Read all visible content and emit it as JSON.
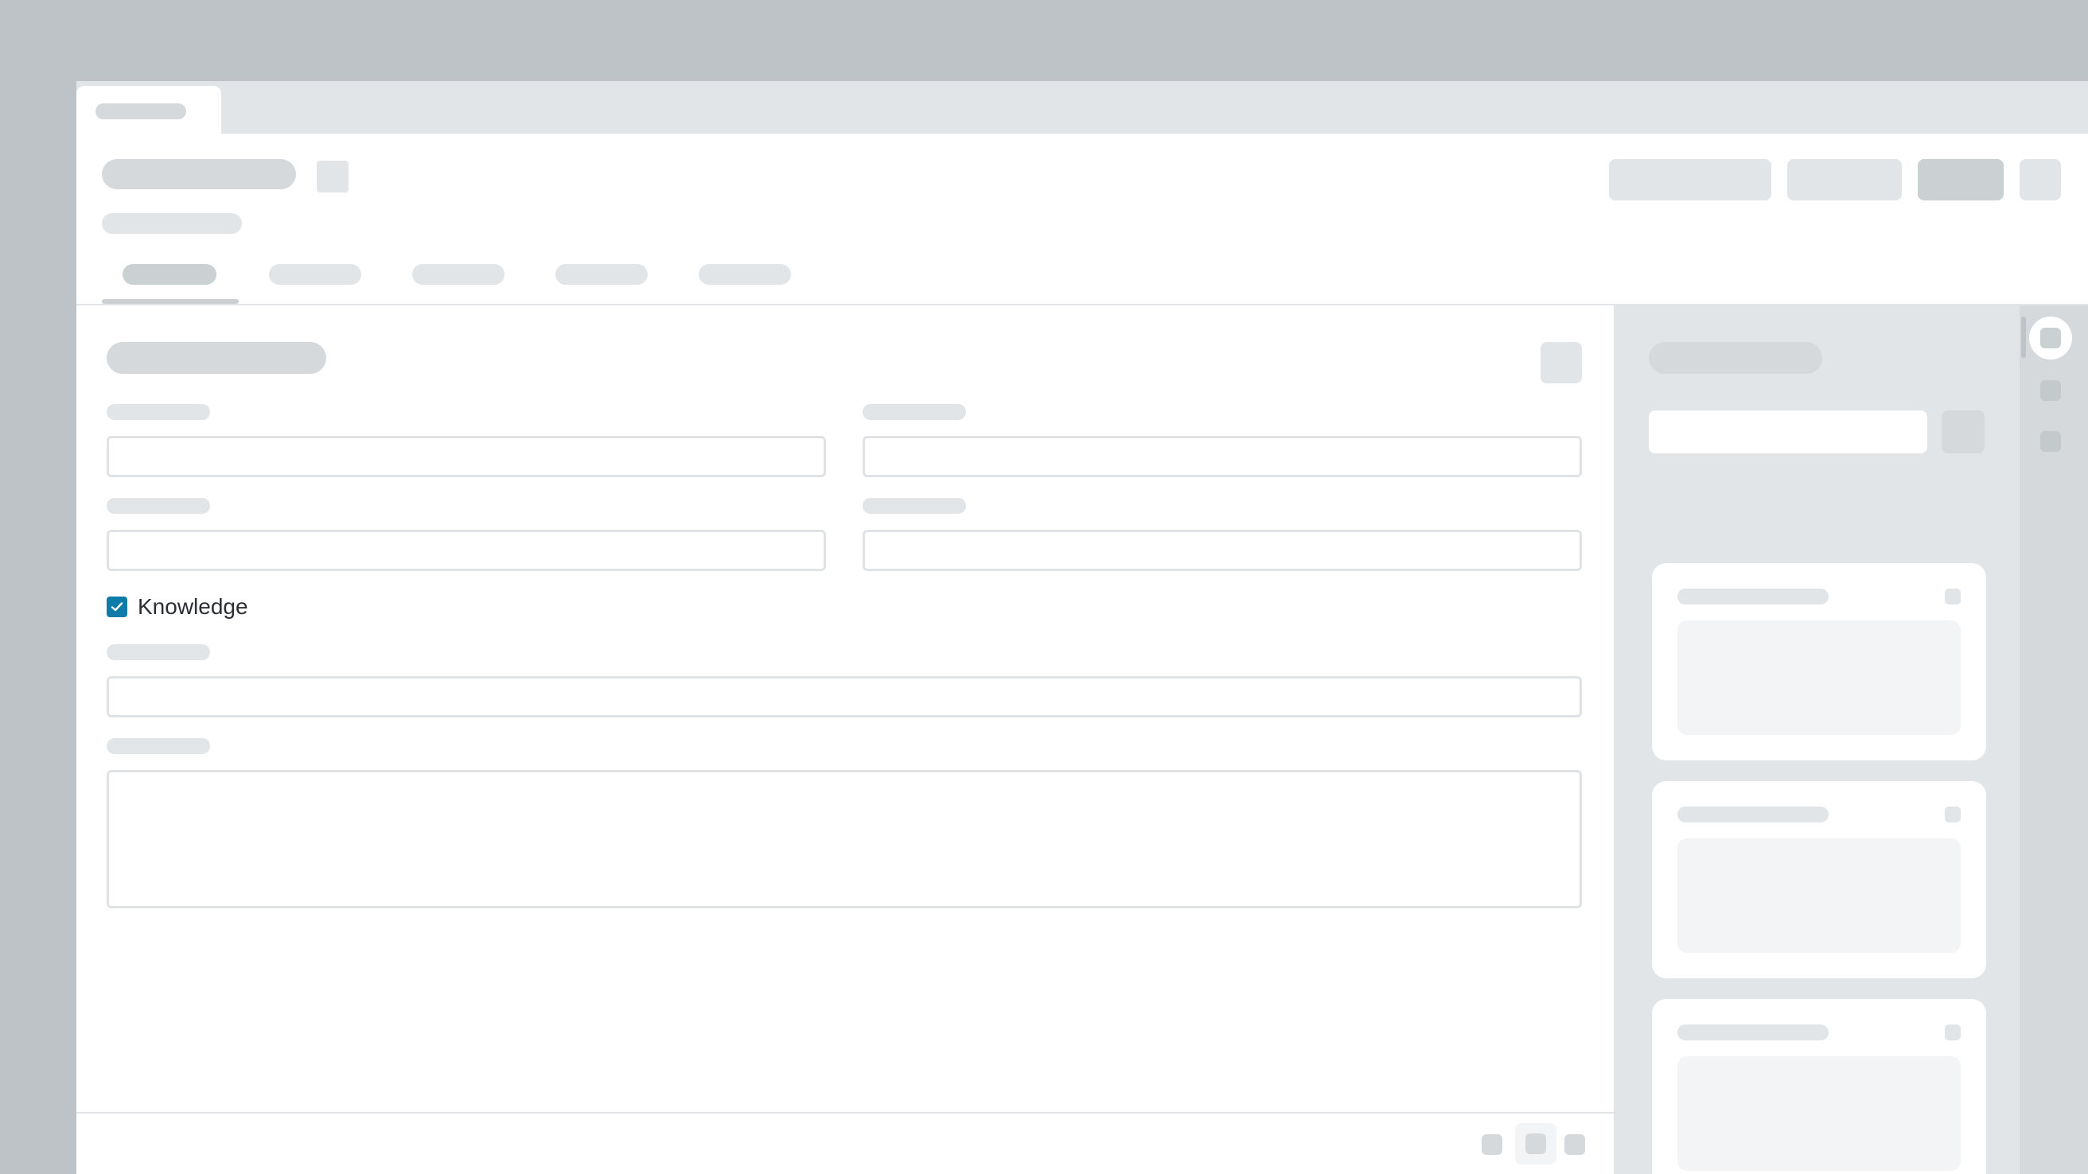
{
  "form": {
    "checkbox": {
      "label": "Knowledge",
      "checked": true
    }
  },
  "colors": {
    "checkbox_accent": "#0f7ba8",
    "placeholder": "#d5d9dc",
    "panel": "#e1e5e8"
  },
  "icons": {
    "checkmark": "check-icon"
  }
}
